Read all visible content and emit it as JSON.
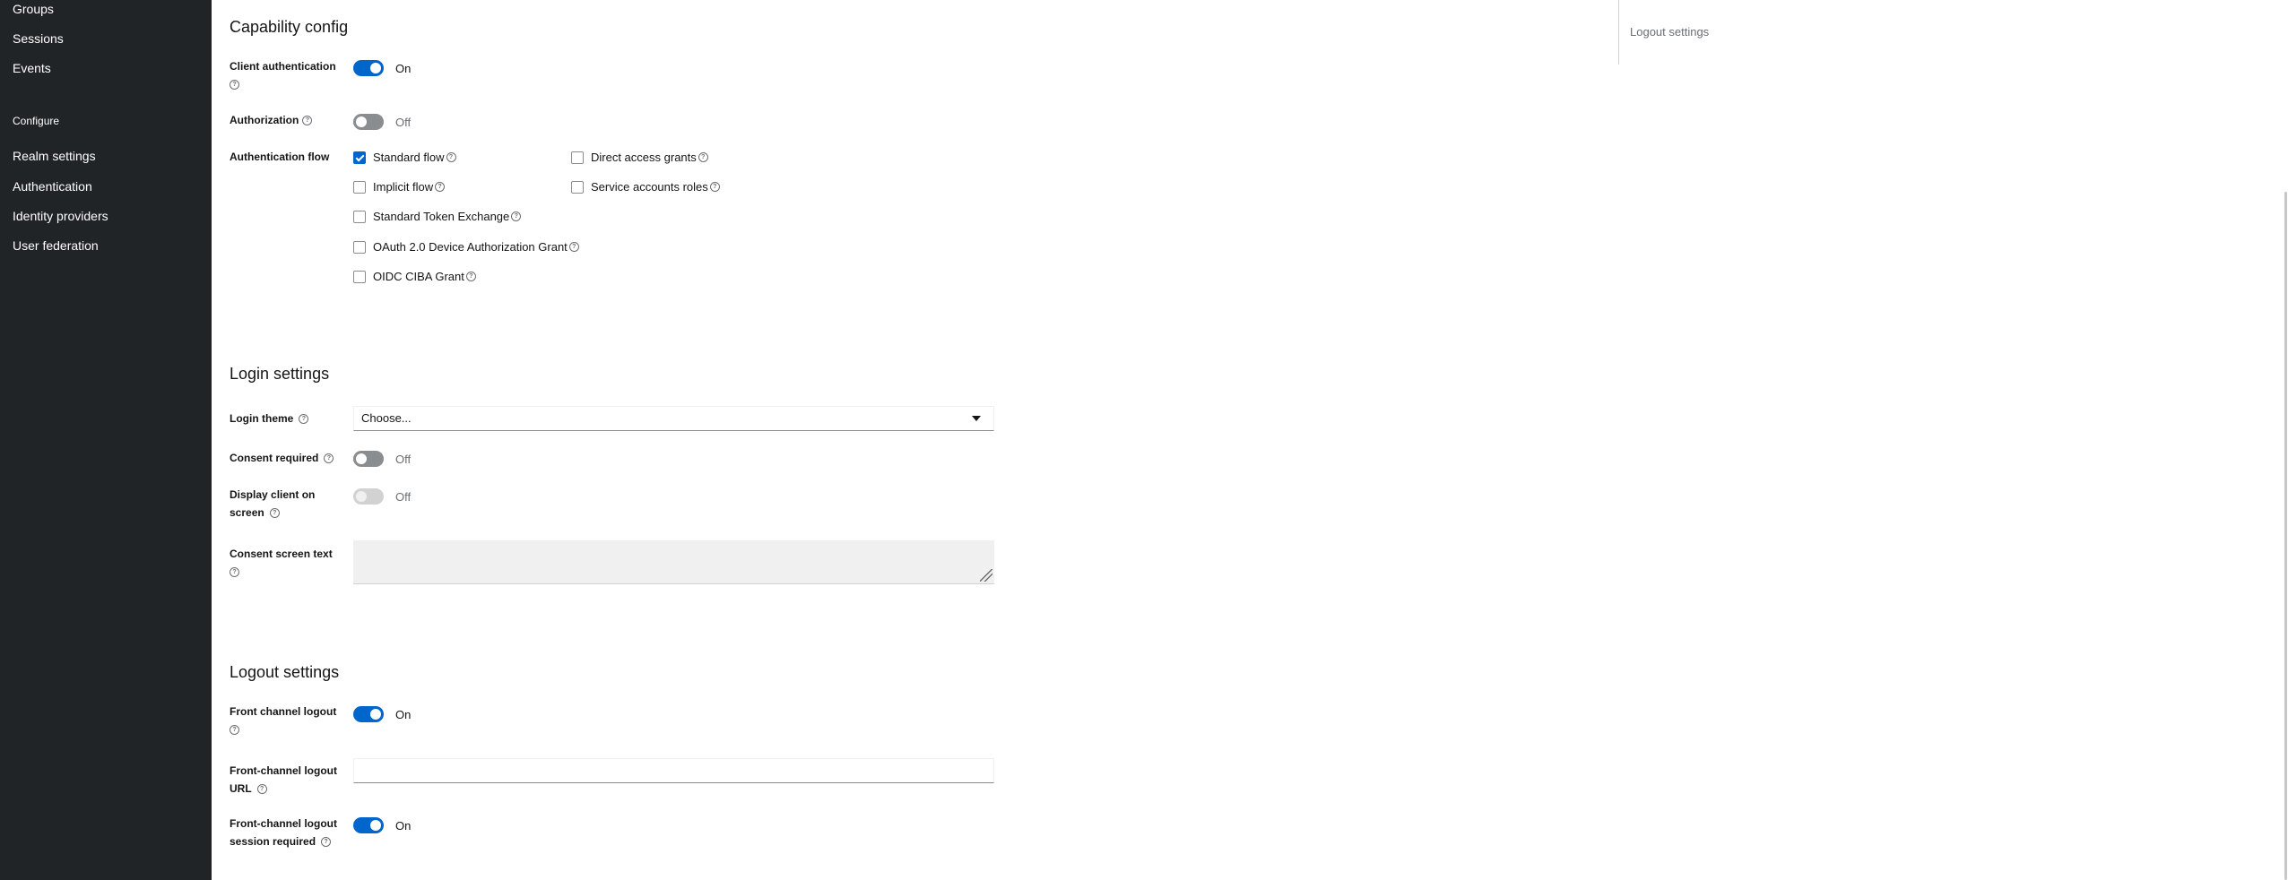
{
  "sidebar": {
    "items_top": [
      "Groups",
      "Sessions",
      "Events"
    ],
    "section_label": "Configure",
    "items_configure": [
      "Realm settings",
      "Authentication",
      "Identity providers",
      "User federation"
    ]
  },
  "capability": {
    "title": "Capability config",
    "client_auth": {
      "label_line1": "Client authentication",
      "state": "On"
    },
    "authorization": {
      "label": "Authorization",
      "state": "Off"
    },
    "auth_flow": {
      "label": "Authentication flow",
      "standard_flow": "Standard flow",
      "direct_access": "Direct access grants",
      "implicit_flow": "Implicit flow",
      "service_accounts": "Service accounts roles",
      "token_exchange": "Standard Token Exchange",
      "device_grant": "OAuth 2.0 Device Authorization Grant",
      "ciba": "OIDC CIBA Grant"
    }
  },
  "login": {
    "title": "Login settings",
    "theme": {
      "label": "Login theme",
      "value": "Choose..."
    },
    "consent_required": {
      "label": "Consent required",
      "state": "Off"
    },
    "display_client": {
      "label_line1": "Display client on",
      "label_line2": "screen",
      "state": "Off"
    },
    "consent_text": {
      "label": "Consent screen text"
    }
  },
  "logout": {
    "title": "Logout settings",
    "front_channel": {
      "label": "Front channel logout",
      "state": "On"
    },
    "front_url": {
      "label_line1": "Front-channel logout",
      "label_line2": "URL"
    },
    "front_session": {
      "label_line1": "Front-channel logout",
      "label_line2": "session required",
      "state": "On"
    }
  },
  "jump_links": {
    "logout": "Logout settings"
  },
  "icons": {
    "help": "help-circle-icon",
    "dropdown": "caret-down-icon"
  },
  "colors": {
    "sidebar_bg": "#212427",
    "accent": "#0066cc",
    "toggle_off": "#8a8d90"
  }
}
